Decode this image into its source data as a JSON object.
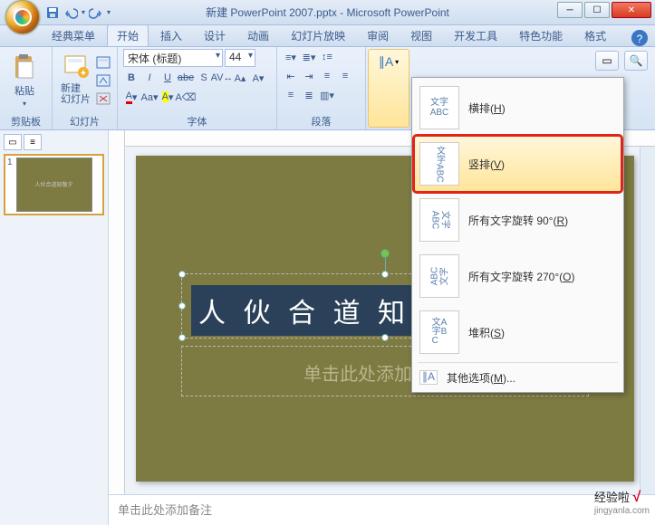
{
  "window": {
    "title": "新建 PowerPoint 2007.pptx - Microsoft PowerPoint"
  },
  "qat": {
    "save": "save-icon",
    "undo": "undo-icon",
    "redo": "redo-icon"
  },
  "tabs": {
    "classic": "经典菜单",
    "home": "开始",
    "insert": "插入",
    "design": "设计",
    "animation": "动画",
    "slideshow": "幻灯片放映",
    "review": "审阅",
    "view": "视图",
    "developer": "开发工具",
    "special": "特色功能",
    "format": "格式"
  },
  "ribbon": {
    "clipboard": {
      "label": "剪贴板",
      "paste": "粘贴"
    },
    "slides": {
      "label": "幻灯片",
      "new_slide": "新建\n幻灯片"
    },
    "font": {
      "label": "字体",
      "font_name": "宋体 (标题)",
      "font_size": "44"
    },
    "paragraph": {
      "label": "段落"
    }
  },
  "text_direction_menu": {
    "horizontal": {
      "label": "横排",
      "key": "H",
      "icon_text": "文字\nABC"
    },
    "vertical": {
      "label": "竖排",
      "key": "V",
      "icon_text": "文字ABC"
    },
    "rotate90": {
      "label": "所有文字旋转 90°",
      "key": "R",
      "icon_text": "文字\nABC"
    },
    "rotate270": {
      "label": "所有文字旋转 270°",
      "key": "O",
      "icon_text": "ABC\n文字"
    },
    "stacked": {
      "label": "堆积",
      "key": "S",
      "icon_text": "文A\n字B\n C"
    },
    "more": {
      "label": "其他选项",
      "key": "M"
    }
  },
  "thumbnail": {
    "number": "1",
    "preview_text": "人伙合道知敬夕"
  },
  "slide": {
    "title_text": "人 伙 合 道 知",
    "subtitle_placeholder": "单击此处添加副标题"
  },
  "notes": {
    "placeholder": "单击此处添加备注"
  },
  "watermark": {
    "brand": "经验啦",
    "url": "jingyanla.com"
  }
}
